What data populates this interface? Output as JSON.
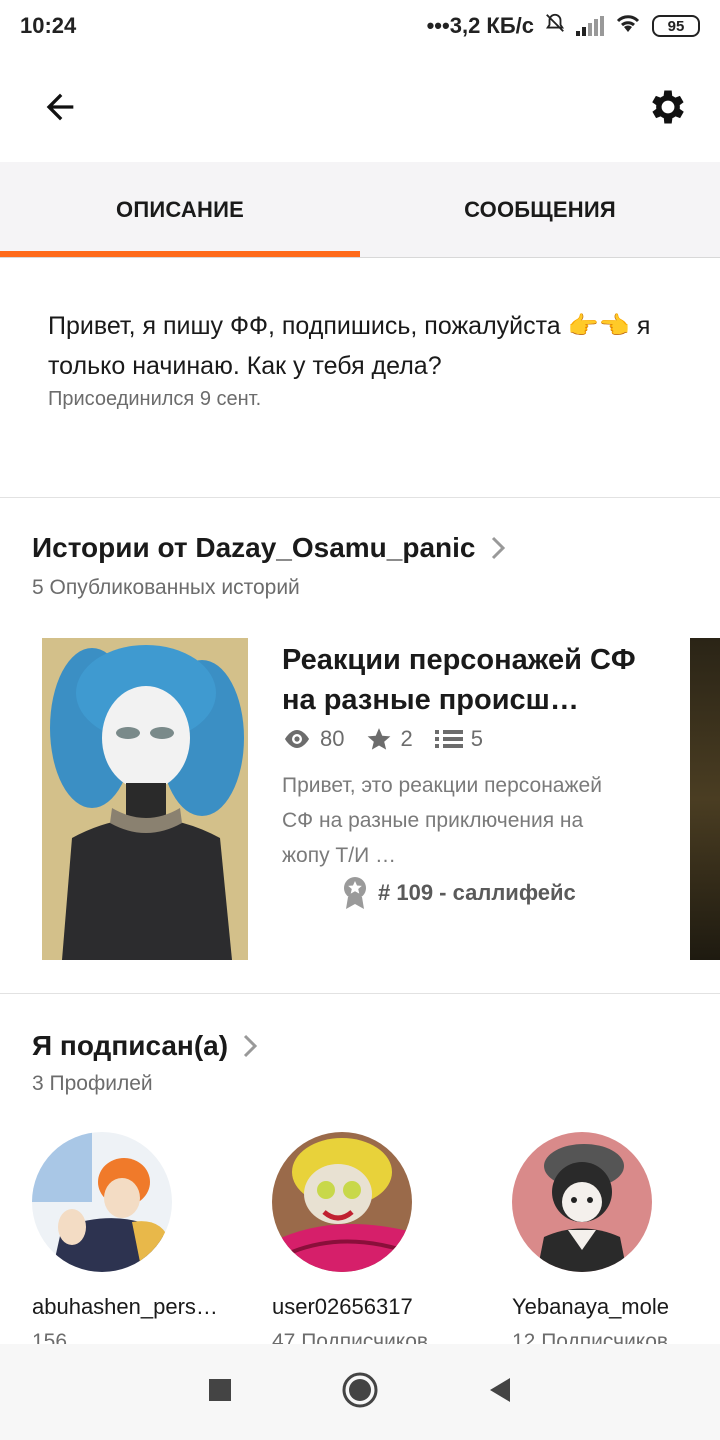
{
  "status_bar": {
    "time": "10:24",
    "network_speed": "•••3,2 КБ/с",
    "battery": "95"
  },
  "tabs": [
    {
      "label": "ОПИСАНИЕ",
      "active": true
    },
    {
      "label": "СООБЩЕНИЯ",
      "active": false
    }
  ],
  "profile": {
    "description": "Привет, я пишу ФФ, подпишись, пожалуйста 👉👈 я только начинаю. Как у тебя дела?",
    "joined": "Присоединился 9 сент."
  },
  "stories_section": {
    "title": "Истории от Dazay_Osamu_panic",
    "subtitle": "5 Опубликованных историй",
    "story": {
      "title": "Реакции персонажей СФ на разные происш…",
      "views": "80",
      "votes": "2",
      "parts": "5",
      "description": "Привет, это реакции персонажей СФ на разные приключения на жопу Т/И …",
      "rank": "# 109 - саллифейс"
    }
  },
  "following_section": {
    "title": "Я подписан(а)",
    "subtitle": "3 Профилей",
    "profiles": [
      {
        "name": "abuhashen_pers…",
        "followers": "156"
      },
      {
        "name": "user02656317",
        "followers": "47 Подписчиков"
      },
      {
        "name": "Yebanaya_mole",
        "followers": "12 Подписчиков"
      }
    ]
  },
  "colors": {
    "accent": "#ff6a1a",
    "tab_bg": "#f5f4f6",
    "muted_text": "#6c6c6c"
  }
}
